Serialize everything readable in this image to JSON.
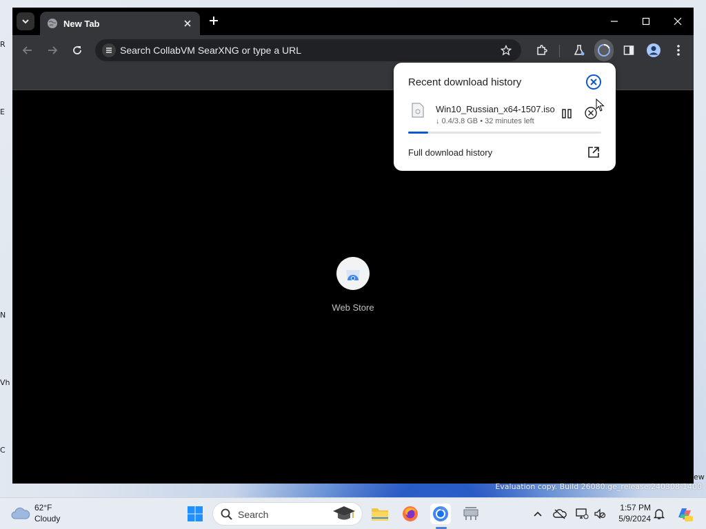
{
  "desktop": {
    "edge_letters": [
      "R",
      "E",
      "N",
      "Vh",
      "C"
    ],
    "watermark": "Evaluation copy. Build 26080.ge_release.240308-1400",
    "watermark_suffix": "ew"
  },
  "browser": {
    "tab": {
      "title": "New Tab",
      "favicon": "globe-icon"
    },
    "omnibox": {
      "placeholder": "Search CollabVM SearXNG or type a URL"
    },
    "shortcut": {
      "label": "Web Store",
      "icon": "web-store-icon"
    }
  },
  "download_bubble": {
    "title": "Recent download history",
    "item": {
      "filename": "Win10_Russian_x64-1507.iso",
      "status": "↓ 0.4/3.8 GB • 32 minutes left",
      "progress": 0.105
    },
    "footer_label": "Full download history"
  },
  "taskbar": {
    "weather": {
      "temp": "62°F",
      "condition": "Cloudy"
    },
    "search_label": "Search",
    "clock": {
      "time": "1:57 PM",
      "date": "5/9/2024"
    }
  },
  "colors": {
    "accent": "#0b57d0",
    "toolbar": "#35363a",
    "tab_strip": "#000000",
    "taskbar": "#e7ecf3"
  }
}
